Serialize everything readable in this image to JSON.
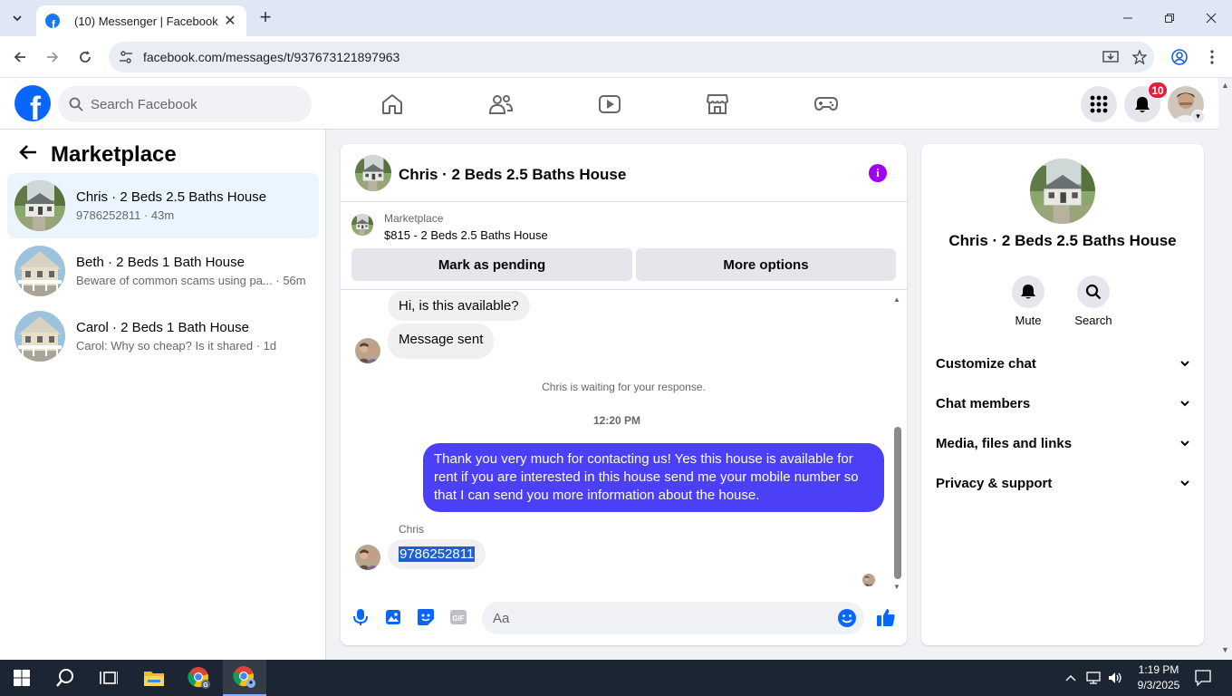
{
  "browser": {
    "tab_title": "(10) Messenger | Facebook",
    "url": "facebook.com/messages/t/937673121897963"
  },
  "fb_header": {
    "search_placeholder": "Search Facebook",
    "notification_count": "10"
  },
  "sidebar": {
    "title": "Marketplace",
    "conversations": [
      {
        "name": "Chris · 2 Beds 2.5 Baths House",
        "preview": "9786252811 · 43m",
        "active": true
      },
      {
        "name": "Beth · 2 Beds 1 Bath House",
        "preview": "Beware of common scams using pa... · 56m",
        "active": false
      },
      {
        "name": "Carol · 2 Beds 1 Bath House",
        "preview": "Carol: Why so cheap? Is it shared · 1d",
        "active": false
      }
    ]
  },
  "chat": {
    "title": "Chris · 2 Beds 2.5 Baths House",
    "marketplace_label": "Marketplace",
    "listing": "$815 - 2 Beds 2.5 Baths House",
    "mark_pending_label": "Mark as pending",
    "more_options_label": "More options",
    "messages": {
      "in_1": "Hi, is this available?",
      "in_2": "Message sent",
      "system": "Chris is waiting for your response.",
      "time": "12:20 PM",
      "out_1": "Thank you very much for contacting us! Yes this house is available for rent if you are interested in this house send me your mobile number so that I can send you more information about the house.",
      "sender": "Chris",
      "in_3": "9786252811"
    },
    "composer_placeholder": "Aa"
  },
  "right_panel": {
    "name": "Chris · 2 Beds 2.5 Baths House",
    "mute_label": "Mute",
    "search_label": "Search",
    "rows": [
      "Customize chat",
      "Chat members",
      "Media, files and links",
      "Privacy & support"
    ]
  },
  "taskbar": {
    "time": "1:19 PM",
    "date": "9/3/2025"
  },
  "colors": {
    "fb_blue": "#0866ff",
    "outgoing_bubble": "#4b3ff7",
    "info_purple": "#a100f2",
    "badge_red": "#e41e3f"
  }
}
